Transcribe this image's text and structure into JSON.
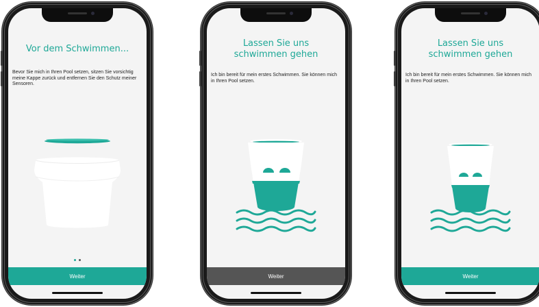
{
  "colors": {
    "accent": "#1ea897",
    "button_active": "#1ea897",
    "button_pressed": "#555555",
    "screen_bg": "#f4f4f4",
    "dot_inactive": "#555555"
  },
  "screens": [
    {
      "title": "Vor dem Schwimmen...",
      "body": "Bevor Sie mich in Ihren Pool setzen, sitzen Sie vorsichtig meine Kappe zurück und entfernen Sie den Schutz meiner Sensoren.",
      "button_label": "Weiter",
      "page_indicator": {
        "count": 2,
        "active": 0
      }
    },
    {
      "title_line1": "Lassen Sie uns",
      "title_line2": "schwimmen gehen",
      "body": "Ich bin bereit für mein erstes Schwimmen. Sie können mich in Ihren Pool setzen.",
      "button_label": "Weiter"
    },
    {
      "title_line1": "Lassen Sie uns",
      "title_line2": "schwimmen gehen",
      "body": "Ich bin bereit für mein erstes Schwimmen. Sie können mich in Ihren Pool setzen.",
      "button_label": "Weiter"
    }
  ],
  "icons": [
    "sensor-device-with-cap-icon",
    "sensor-device-floating-icon",
    "water-waves-icon"
  ]
}
